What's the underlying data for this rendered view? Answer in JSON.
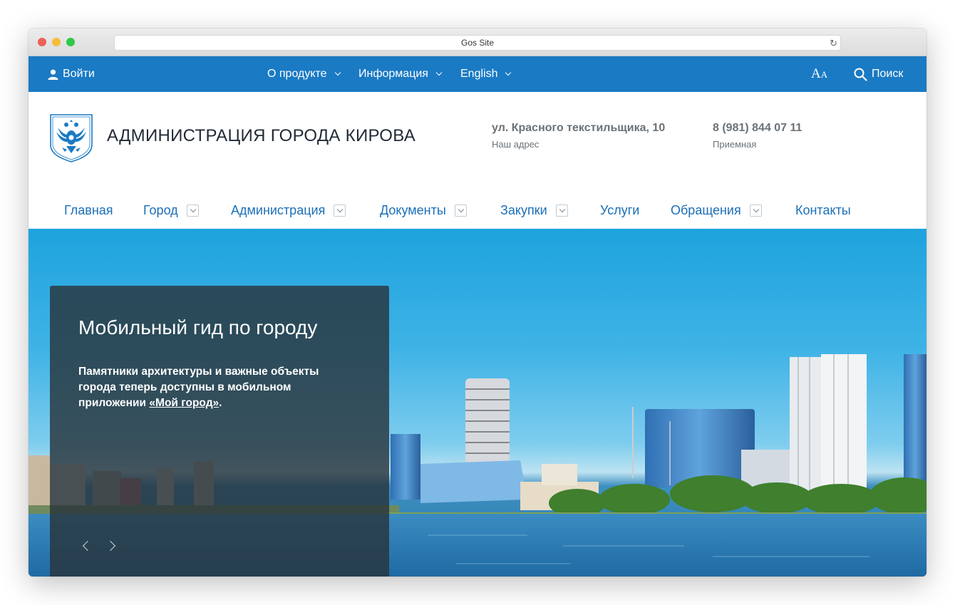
{
  "browser": {
    "title": "Gos Site",
    "traffic_colors": [
      "#ee5f58",
      "#f6bd3a",
      "#2ec94b"
    ]
  },
  "topbar": {
    "login": "Войти",
    "menu": [
      "О продукте",
      "Информация",
      "English"
    ],
    "font_size_label_big": "A",
    "font_size_label_small": "A",
    "search": "Поиск",
    "bg_color": "#1a7ac4"
  },
  "header": {
    "title": "АДМИНИСТРАЦИЯ ГОРОДА КИРОВА",
    "address": {
      "value": "ул. Красного текстильщика, 10",
      "label": "Наш адрес"
    },
    "phone": {
      "value": "8 (981) 844 07 11",
      "label": "Приемная"
    }
  },
  "nav": {
    "items": [
      {
        "label": "Главная",
        "dropdown": false
      },
      {
        "label": "Город",
        "dropdown": true
      },
      {
        "label": "Администрация",
        "dropdown": true
      },
      {
        "label": "Документы",
        "dropdown": true
      },
      {
        "label": "Закупки",
        "dropdown": true
      },
      {
        "label": "Услуги",
        "dropdown": false
      },
      {
        "label": "Обращения",
        "dropdown": true
      },
      {
        "label": "Контакты",
        "dropdown": false
      }
    ]
  },
  "hero": {
    "title": "Мобильный гид по городу",
    "text_before": "Памятники архитектуры и важные объекты города теперь доступны в мобильном приложении ",
    "link": "«Мой город»",
    "text_after": "."
  }
}
